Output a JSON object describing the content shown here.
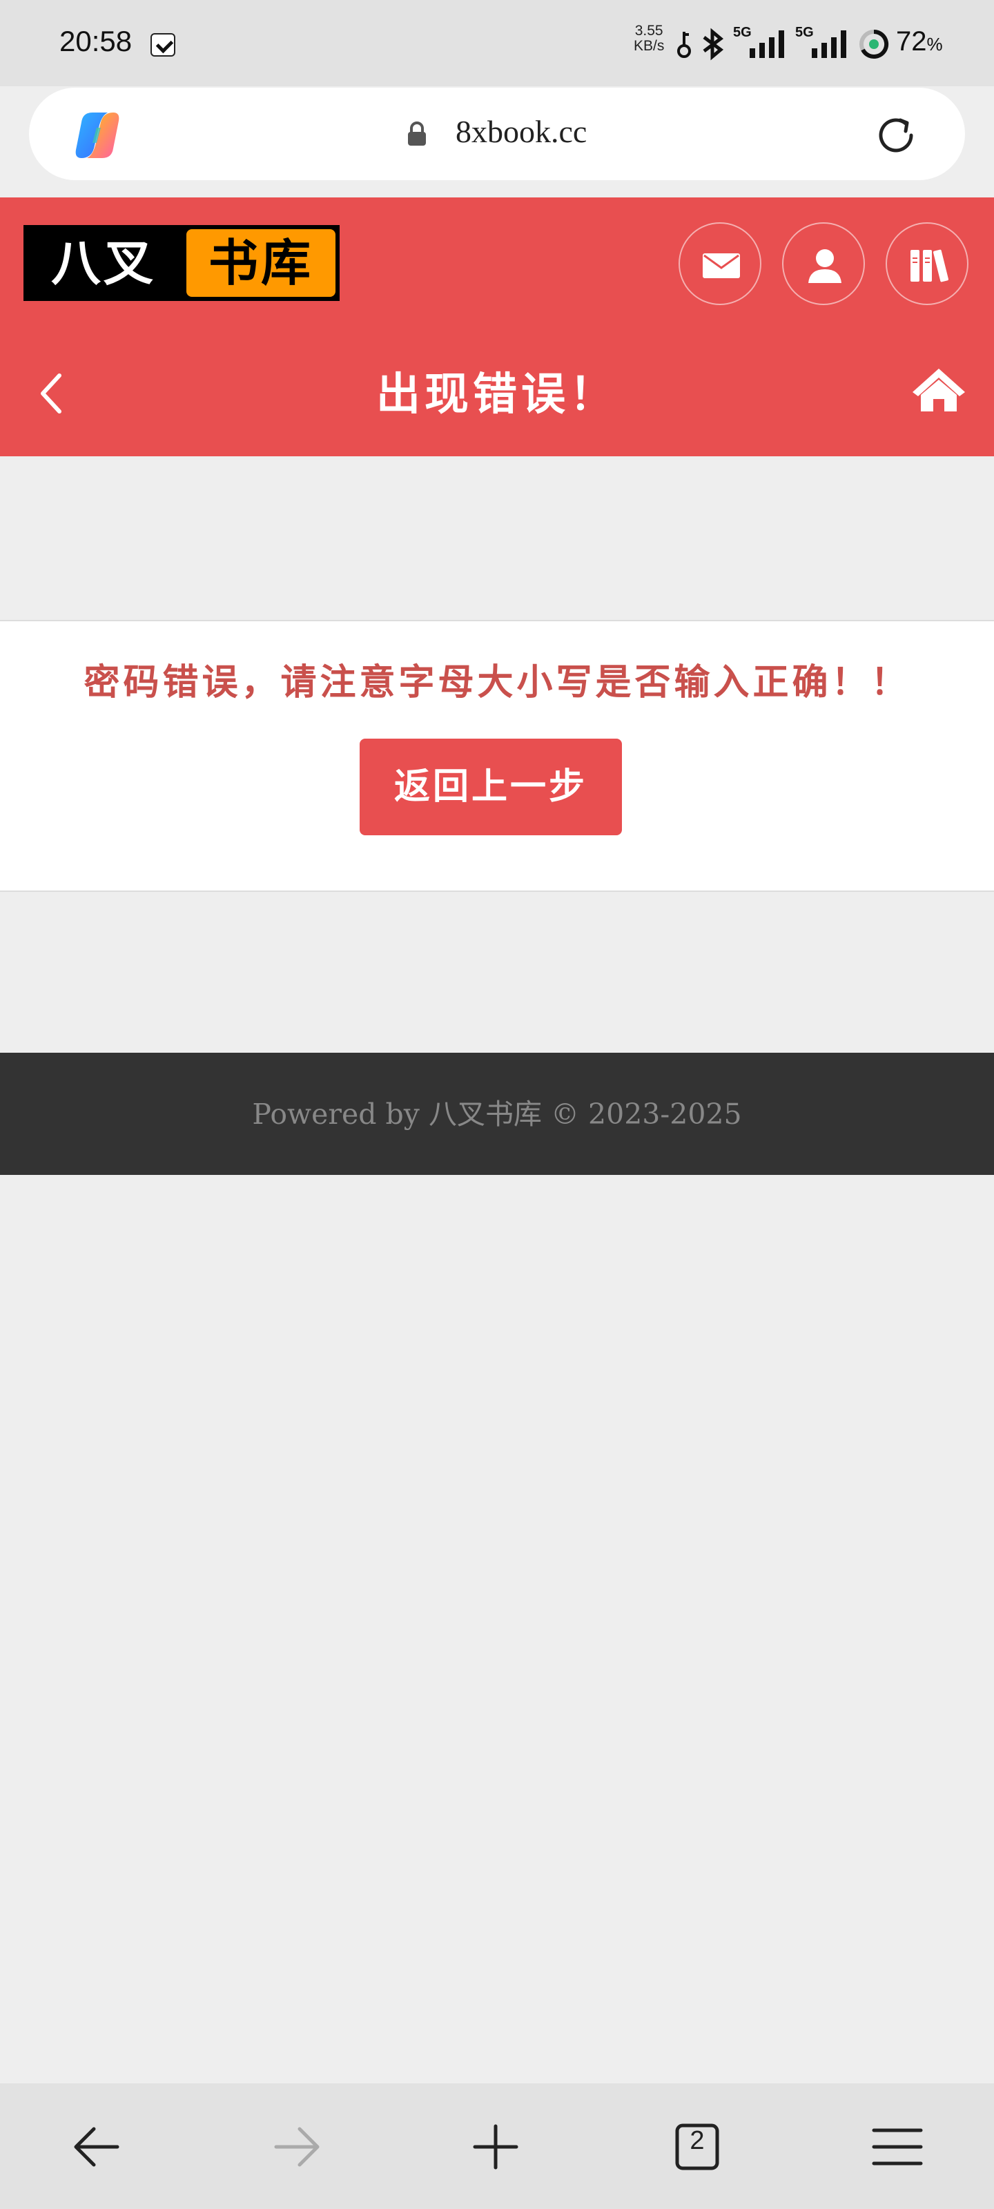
{
  "status_bar": {
    "time": "20:58",
    "net_speed_value": "3.55",
    "net_speed_unit": "KB/s",
    "network_1": "5G",
    "network_2": "5G",
    "battery_percent": "72",
    "battery_unit": "%"
  },
  "browser": {
    "url": "8xbook.cc",
    "open_tabs": "2"
  },
  "site": {
    "logo_left": "八叉",
    "logo_right": "书库",
    "page_title": "出现错误！",
    "error_message": "密码错误，请注意字母大小写是否输入正确！！",
    "return_button": "返回上一步",
    "footer": "Powered by 八叉书库 © 2023-2025"
  },
  "colors": {
    "brand_red": "#e84f50",
    "logo_orange": "#ff9900",
    "footer_bg": "#333333"
  },
  "icons": [
    "copilot-icon",
    "lock-icon",
    "reload-icon",
    "mail-icon",
    "user-icon",
    "bookshelf-icon",
    "back-chevron-icon",
    "home-icon",
    "back-arrow-icon",
    "forward-arrow-icon",
    "new-tab-icon",
    "tabs-icon",
    "menu-icon"
  ]
}
